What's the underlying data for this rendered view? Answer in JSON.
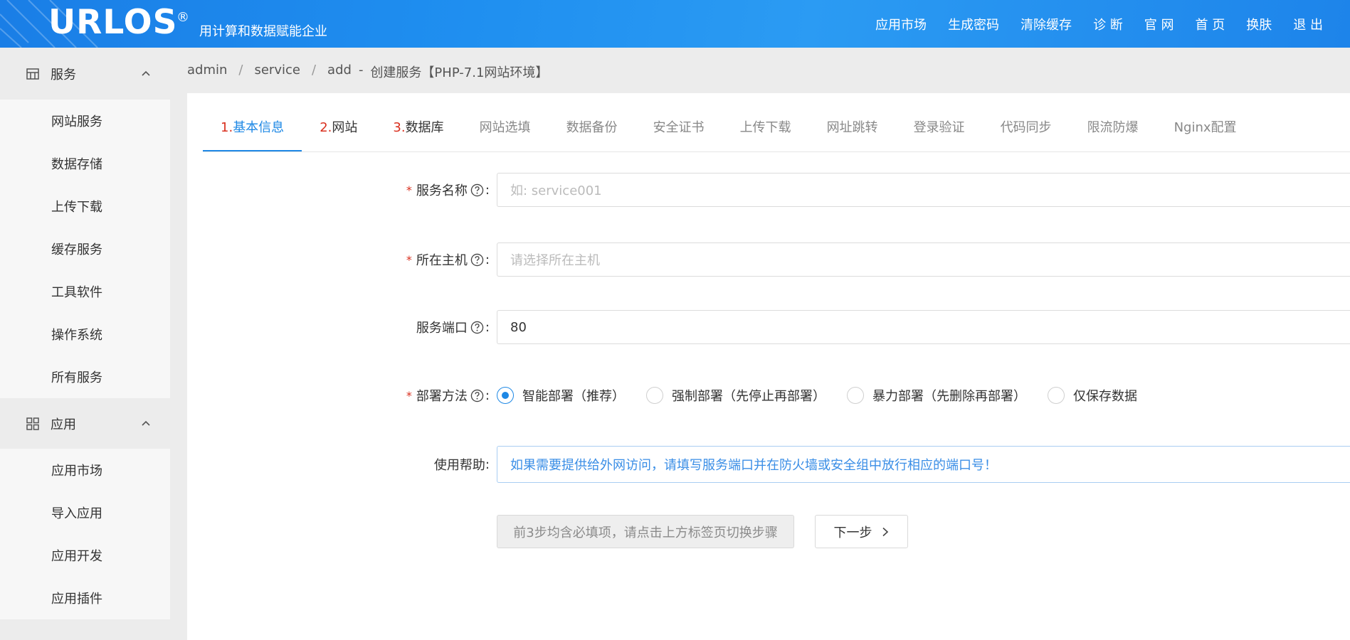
{
  "header": {
    "logo": "URLOS",
    "logo_mark": "®",
    "slogan": "用计算和数据赋能企业",
    "nav": [
      "应用市场",
      "生成密码",
      "清除缓存",
      "诊 断",
      "官 网",
      "首 页",
      "换肤",
      "退 出"
    ]
  },
  "sidebar": {
    "groups": [
      {
        "label": "服务",
        "icon": "service-icon",
        "items": [
          "网站服务",
          "数据存储",
          "上传下载",
          "缓存服务",
          "工具软件",
          "操作系统",
          "所有服务"
        ]
      },
      {
        "label": "应用",
        "icon": "apps-grid-icon",
        "items": [
          "应用市场",
          "导入应用",
          "应用开发",
          "应用插件"
        ]
      }
    ]
  },
  "breadcrumb": {
    "items": [
      "admin",
      "service",
      "add"
    ],
    "separator": "/",
    "dash": "-",
    "title": "创建服务【PHP-7.1网站环境】"
  },
  "tabs": [
    {
      "num": "1.",
      "label": "基本信息",
      "active": true
    },
    {
      "num": "2.",
      "label": "网站",
      "active": false
    },
    {
      "num": "3.",
      "label": "数据库",
      "active": false
    },
    {
      "num": "",
      "label": "网站选填",
      "active": false
    },
    {
      "num": "",
      "label": "数据备份",
      "active": false
    },
    {
      "num": "",
      "label": "安全证书",
      "active": false
    },
    {
      "num": "",
      "label": "上传下载",
      "active": false
    },
    {
      "num": "",
      "label": "网址跳转",
      "active": false
    },
    {
      "num": "",
      "label": "登录验证",
      "active": false
    },
    {
      "num": "",
      "label": "代码同步",
      "active": false
    },
    {
      "num": "",
      "label": "限流防爆",
      "active": false
    },
    {
      "num": "",
      "label": "Nginx配置",
      "active": false
    }
  ],
  "form": {
    "required_mark": "*",
    "colon": ":",
    "service_name": {
      "label": "服务名称",
      "value": "",
      "placeholder": "如: service001"
    },
    "host": {
      "label": "所在主机",
      "value": "",
      "placeholder": "请选择所在主机"
    },
    "port": {
      "label": "服务端口",
      "value": "80"
    },
    "deploy": {
      "label": "部署方法",
      "options": [
        "智能部署（推荐）",
        "强制部署（先停止再部署）",
        "暴力部署（先删除再部署）",
        "仅保存数据"
      ],
      "selected": 0
    },
    "help": {
      "label": "使用帮助",
      "text": "如果需要提供给外网访问，请填写服务端口并在防火墙或安全组中放行相应的端口号！"
    }
  },
  "buttons": {
    "hint": "前3步均含必填项，请点击上方标签页切换步骤",
    "next": "下一步"
  },
  "colors": {
    "header_blue": "#1f8ff0",
    "accent": "#1e88e5",
    "required_red": "#d9301f"
  }
}
